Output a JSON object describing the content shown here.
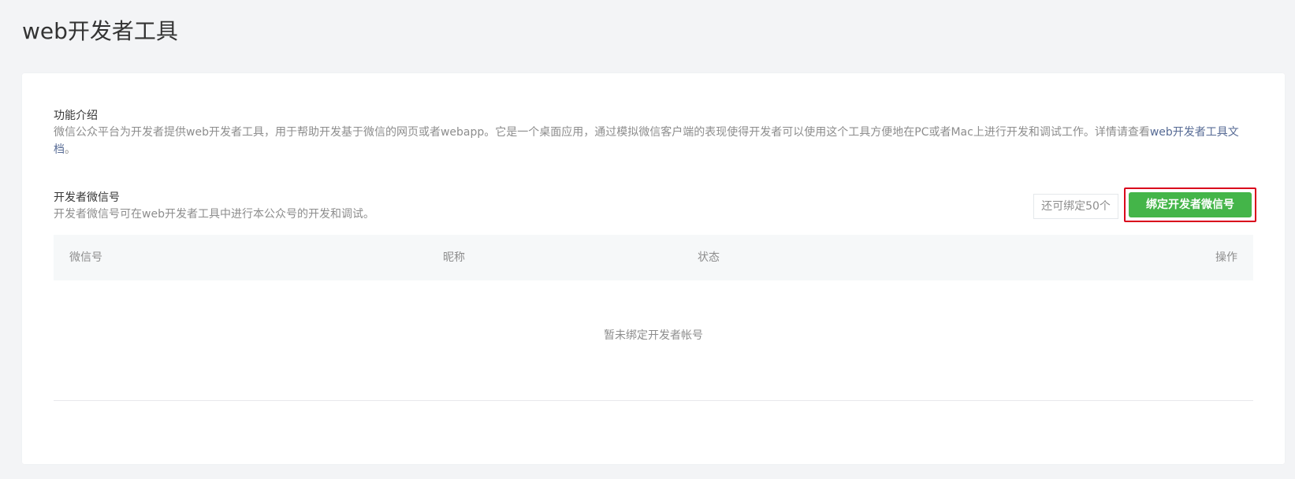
{
  "page": {
    "title": "web开发者工具"
  },
  "intro": {
    "title": "功能介绍",
    "text": "微信公众平台为开发者提供web开发者工具，用于帮助开发基于微信的网页或者webapp。它是一个桌面应用，通过模拟微信客户端的表现使得开发者可以使用这个工具方便地在PC或者Mac上进行开发和调试工作。详情请查看",
    "link_text": "web开发者工具文档",
    "suffix": "。"
  },
  "developers": {
    "title": "开发者微信号",
    "description": "开发者微信号可在web开发者工具中进行本公众号的开发和调试。",
    "remaining_label": "还可绑定50个",
    "bind_button_label": "绑定开发者微信号"
  },
  "table": {
    "columns": [
      "微信号",
      "昵称",
      "状态",
      "操作"
    ],
    "rows": [],
    "empty_message": "暂未绑定开发者帐号"
  },
  "colors": {
    "primary_green": "#44b549",
    "highlight_red": "#d9001b",
    "link_blue": "#576b95",
    "muted_text": "#8d8d8d"
  }
}
